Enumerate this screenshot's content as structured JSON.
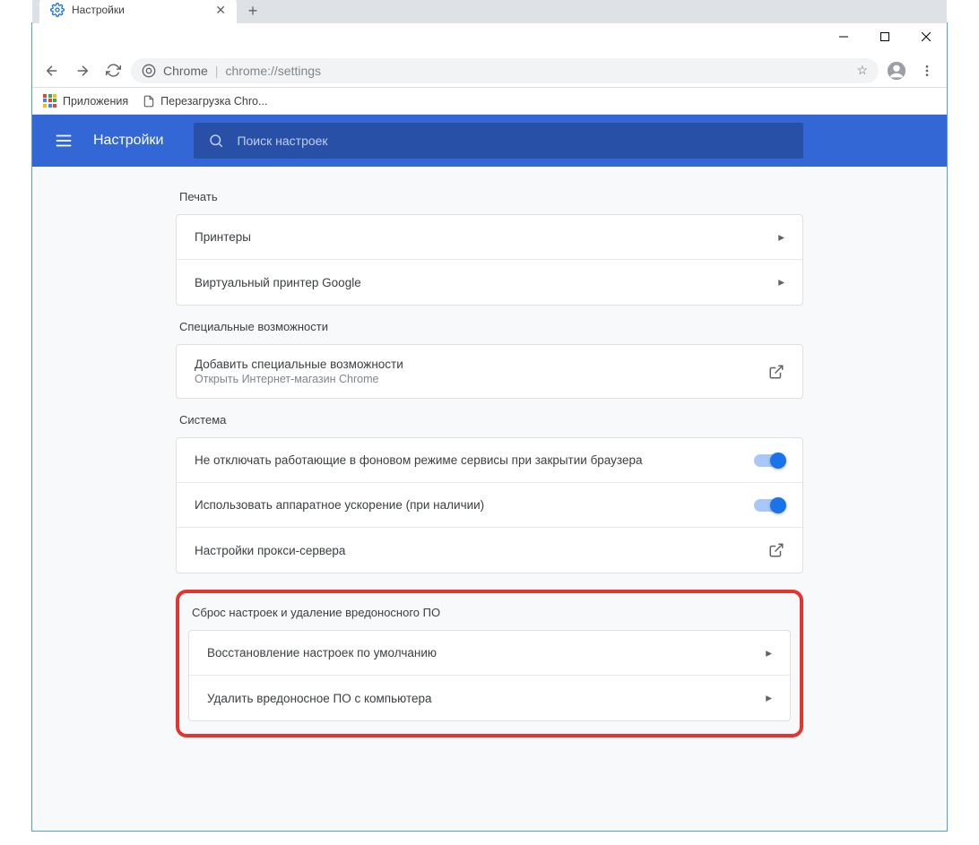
{
  "window": {
    "tab_title": "Настройки",
    "omnibox_label": "Chrome",
    "omnibox_url": "chrome://settings"
  },
  "bookmarks": {
    "apps": "Приложения",
    "reload": "Перезагрузка Chro..."
  },
  "header": {
    "title": "Настройки",
    "search_placeholder": "Поиск настроек"
  },
  "sections": {
    "print": {
      "title": "Печать",
      "rows": [
        "Принтеры",
        "Виртуальный принтер Google"
      ]
    },
    "accessibility": {
      "title": "Специальные возможности",
      "row_title": "Добавить специальные возможности",
      "row_sub": "Открыть Интернет-магазин Chrome"
    },
    "system": {
      "title": "Система",
      "rows": [
        "Не отключать работающие в фоновом режиме сервисы при закрытии браузера",
        "Использовать аппаратное ускорение (при наличии)",
        "Настройки прокси-сервера"
      ]
    },
    "reset": {
      "title": "Сброс настроек и удаление вредоносного ПО",
      "rows": [
        "Восстановление настроек по умолчанию",
        "Удалить вредоносное ПО с компьютера"
      ]
    }
  }
}
